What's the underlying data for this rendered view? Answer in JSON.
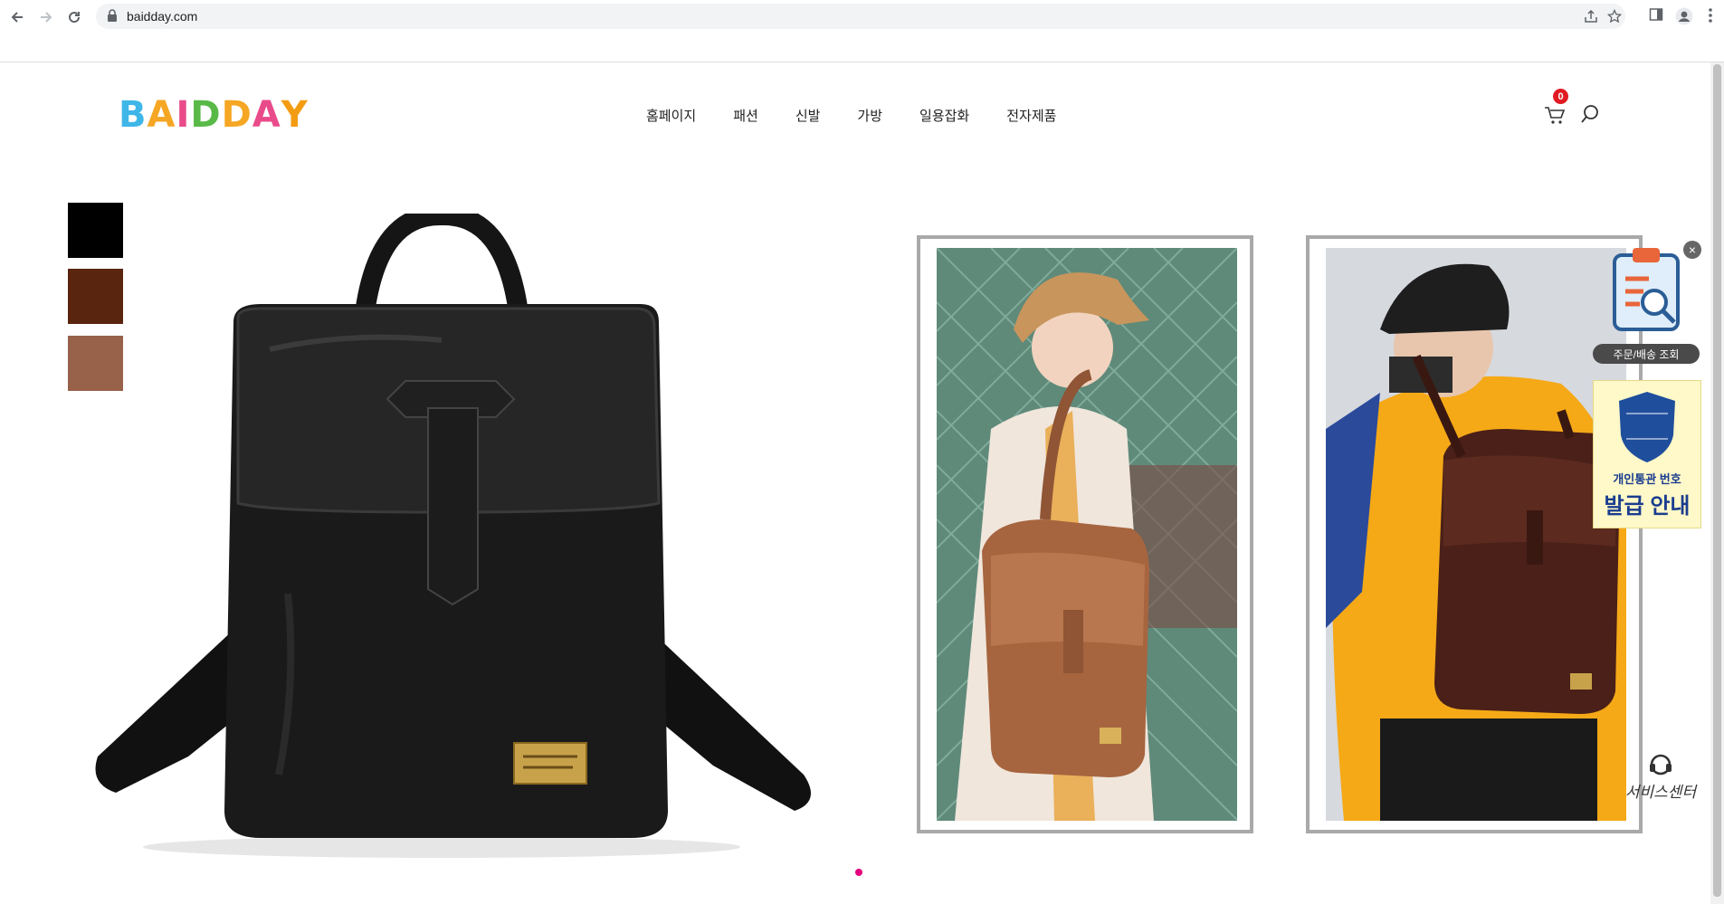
{
  "browser": {
    "url": "baidday.com",
    "icons": [
      "back-icon",
      "forward-icon",
      "reload-icon",
      "lock-icon",
      "share-icon",
      "star-icon",
      "sidepanel-icon",
      "profile-icon",
      "menu-icon"
    ]
  },
  "header": {
    "logo_letters": [
      "B",
      "A",
      "I",
      "D",
      "D",
      "A",
      "Y"
    ],
    "logo_colors": [
      "#3fb6e8",
      "#f5a623",
      "#e94b8a",
      "#58b947",
      "#f5a623",
      "#e94b8a",
      "#f39c12"
    ],
    "menu": [
      {
        "label": "홈페이지"
      },
      {
        "label": "패션"
      },
      {
        "label": "신발"
      },
      {
        "label": "가방"
      },
      {
        "label": "일용잡화"
      },
      {
        "label": "전자제품"
      }
    ],
    "cart_count": "0"
  },
  "swatches": [
    {
      "name": "black",
      "color": "#000000"
    },
    {
      "name": "dark-brown",
      "color": "#5a250e"
    },
    {
      "name": "light-brown",
      "color": "#98614a"
    }
  ],
  "floating": {
    "order_label": "주문/배송 조회",
    "customs_line1": "개인통관 번호",
    "customs_line2": "발급 안내",
    "service_label": "서비스센터"
  },
  "colors": {
    "accent_dot": "#e5007f",
    "badge": "#e01b24"
  }
}
